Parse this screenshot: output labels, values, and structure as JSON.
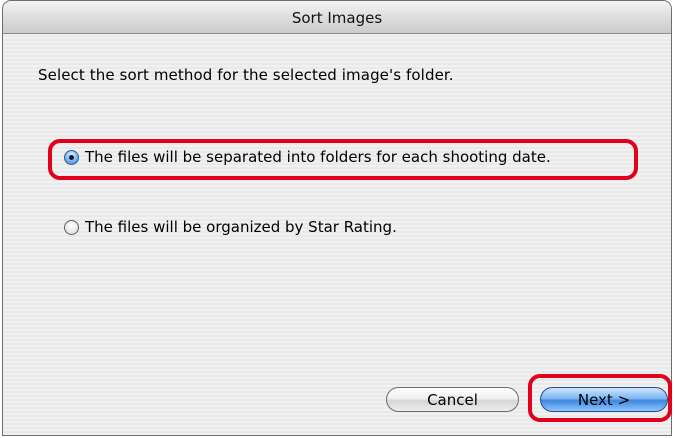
{
  "window": {
    "title": "Sort Images"
  },
  "dialog": {
    "instruction": "Select the sort method for the selected image's folder.",
    "options": [
      {
        "label": "The files will be separated into folders for each shooting date.",
        "selected": true
      },
      {
        "label": "The files will be organized by Star Rating.",
        "selected": false
      }
    ]
  },
  "buttons": {
    "cancel_label": "Cancel",
    "next_label": "Next >"
  },
  "colors": {
    "highlight": "#e0001b",
    "default_button": "#3f86dc"
  }
}
